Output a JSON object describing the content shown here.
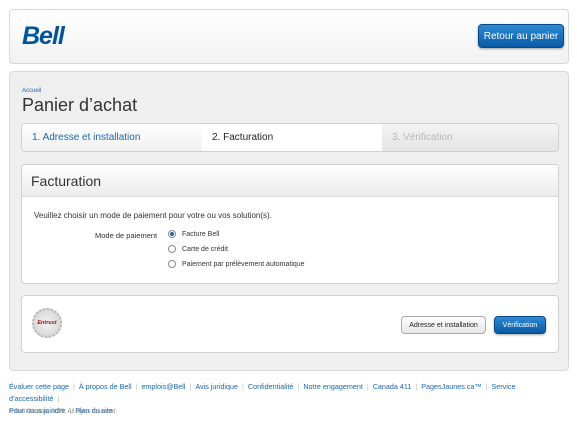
{
  "header": {
    "logo": "Bell",
    "back_button": "Retour au panier"
  },
  "breadcrumb": "Accueil",
  "page_title": "Panier d’achat",
  "steps": [
    {
      "label": "1. Adresse et installation"
    },
    {
      "label": "2. Facturation"
    },
    {
      "label": "3. Vérification"
    }
  ],
  "billing": {
    "heading": "Facturation",
    "description": "Veuillez choisir un mode de paiement pour votre ou vos solution(s).",
    "payment_label": "Mode de paiement",
    "options": [
      "Facture Bell",
      "Carte de crédit",
      "Paiement par prélèvement automatique"
    ],
    "selected": "Facture Bell"
  },
  "actions": {
    "seal": "Entrust",
    "prev_button": "Adresse et installation",
    "next_button": "Vérification"
  },
  "footer": {
    "links": [
      "Évaluer cette page",
      "À propos de Bell",
      "emplois@Bell",
      "Avis juridique",
      "Confidentialité",
      "Notre engagement",
      "Canada 411",
      "PagesJaunes.ca™",
      "Service d’accessibilité",
      "Pour nous joindre",
      "Plan du site"
    ],
    "copyright": "© Bell Canada, 2009. All rights reserved."
  },
  "colors": {
    "brand": "#00549a",
    "accent": "#1a66b0"
  }
}
